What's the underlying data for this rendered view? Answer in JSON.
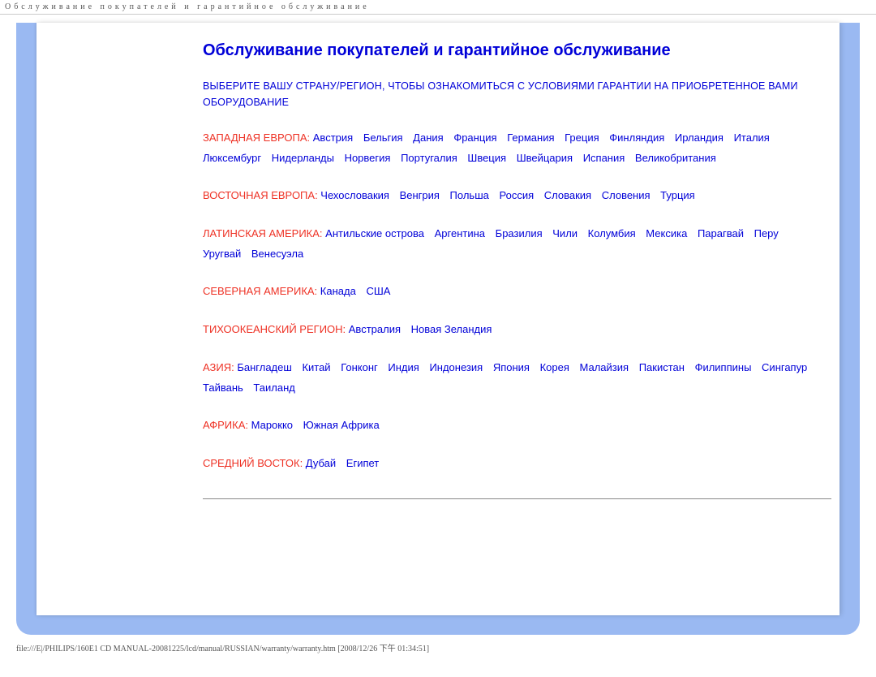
{
  "top_bar": "Обслуживание покупателей и гарантийное обслуживание",
  "title": "Обслуживание покупателей и гарантийное обслуживание",
  "intro": "ВЫБЕРИТЕ ВАШУ СТРАНУ/РЕГИОН, ЧТОБЫ ОЗНАКОМИТЬСЯ С УСЛОВИЯМИ ГАРАНТИИ НА ПРИОБРЕТЕННОЕ ВАМИ ОБОРУДОВАНИЕ",
  "regions": [
    {
      "label": "ЗАПАДНАЯ ЕВРОПА:",
      "countries": [
        "Австрия",
        "Бельгия",
        "Дания",
        "Франция",
        "Германия",
        "Греция",
        "Финляндия",
        "Ирландия",
        "Италия",
        "Люксембург",
        "Нидерланды",
        "Норвегия",
        "Португалия",
        "Швеция",
        "Швейцария",
        "Испания",
        "Великобритания"
      ]
    },
    {
      "label": "ВОСТОЧНАЯ ЕВРОПА:",
      "countries": [
        "Чехословакия",
        "Венгрия",
        "Польша",
        "Россия",
        "Словакия",
        "Словения",
        "Турция"
      ]
    },
    {
      "label": "ЛАТИНСКАЯ АМЕРИКА:",
      "countries": [
        "Антильские острова",
        "Аргентина",
        "Бразилия",
        "Чили",
        "Колумбия",
        "Мексика",
        "Парагвай",
        "Перу",
        "Уругвай",
        "Венесуэла"
      ]
    },
    {
      "label": "СЕВЕРНАЯ АМЕРИКА:",
      "countries": [
        "Канада",
        "США"
      ]
    },
    {
      "label": "ТИХООКЕАНСКИЙ РЕГИОН:",
      "countries": [
        "Австралия",
        "Новая Зеландия"
      ]
    },
    {
      "label": "АЗИЯ:",
      "countries": [
        "Бангладеш",
        "Китай",
        "Гонконг",
        "Индия",
        "Индонезия",
        "Япония",
        "Корея",
        "Малайзия",
        "Пакистан",
        "Филиппины",
        "Сингапур",
        "Тайвань",
        "Таиланд"
      ]
    },
    {
      "label": "АФРИКА:",
      "countries": [
        "Марокко",
        "Южная Африка"
      ]
    },
    {
      "label": "СРЕДНИЙ ВОСТОК:",
      "countries": [
        "Дубай",
        "Египет"
      ]
    }
  ],
  "footer_path": "file:///E|/PHILIPS/160E1 CD MANUAL-20081225/lcd/manual/RUSSIAN/warranty/warranty.htm [2008/12/26 下午 01:34:51]"
}
